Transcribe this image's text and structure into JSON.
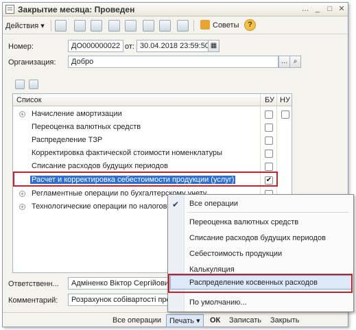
{
  "window": {
    "title": "Закрытие месяца: Проведен"
  },
  "toolbar": {
    "actions_label": "Действия",
    "sovety_label": "Советы"
  },
  "form": {
    "nomer_label": "Номер:",
    "nomer_value": "ДО000000022",
    "ot_label": "от:",
    "date_value": "30.04.2018 23:59:50",
    "org_label": "Организация:",
    "org_value": "Добро",
    "resp_label": "Ответственн...",
    "resp_value": "Адміненко Віктор Сергійович",
    "comment_label": "Комментарий:",
    "comment_value": "Розрахунок собівартості продукції"
  },
  "table": {
    "headers": [
      "Список",
      "БУ",
      "НУ"
    ],
    "rows": [
      {
        "label": "Начисление амортизации",
        "expand": true,
        "bu": false,
        "nu": false
      },
      {
        "label": "Переоценка валютных средств",
        "expand": false,
        "bu": false,
        "nu": null
      },
      {
        "label": "Распределение ТЗР",
        "expand": false,
        "bu": false,
        "nu": null
      },
      {
        "label": "Корректировка фактической стоимости номенклатуры",
        "expand": false,
        "bu": false,
        "nu": null
      },
      {
        "label": "Списание расходов будущих периодов",
        "expand": false,
        "bu": false,
        "nu": null
      },
      {
        "label": "Расчет и корректировка себестоимости продукции (услуг)",
        "expand": false,
        "bu": true,
        "nu": null,
        "selected": true
      },
      {
        "label": "Регламентные операции по бухгалтерскому учету",
        "expand": true,
        "bu": false,
        "nu": null
      },
      {
        "label": "Технологические операции по налоговому учету",
        "expand": true,
        "bu": null,
        "nu": null
      }
    ]
  },
  "popup": {
    "items": [
      "Все операции",
      "Переоценка валютных средств",
      "Списание расходов будущих периодов",
      "Себестоимость продукции",
      "Калькуляция",
      "Распределение косвенных расходов",
      "По умолчанию..."
    ]
  },
  "bottom": {
    "all_ops": "Все операции",
    "print": "Печать",
    "ok": "ОК",
    "save": "Записать",
    "close": "Закрыть"
  },
  "colors": {
    "selection": "#2f6fd0",
    "highlight_box": "#c8202a"
  }
}
